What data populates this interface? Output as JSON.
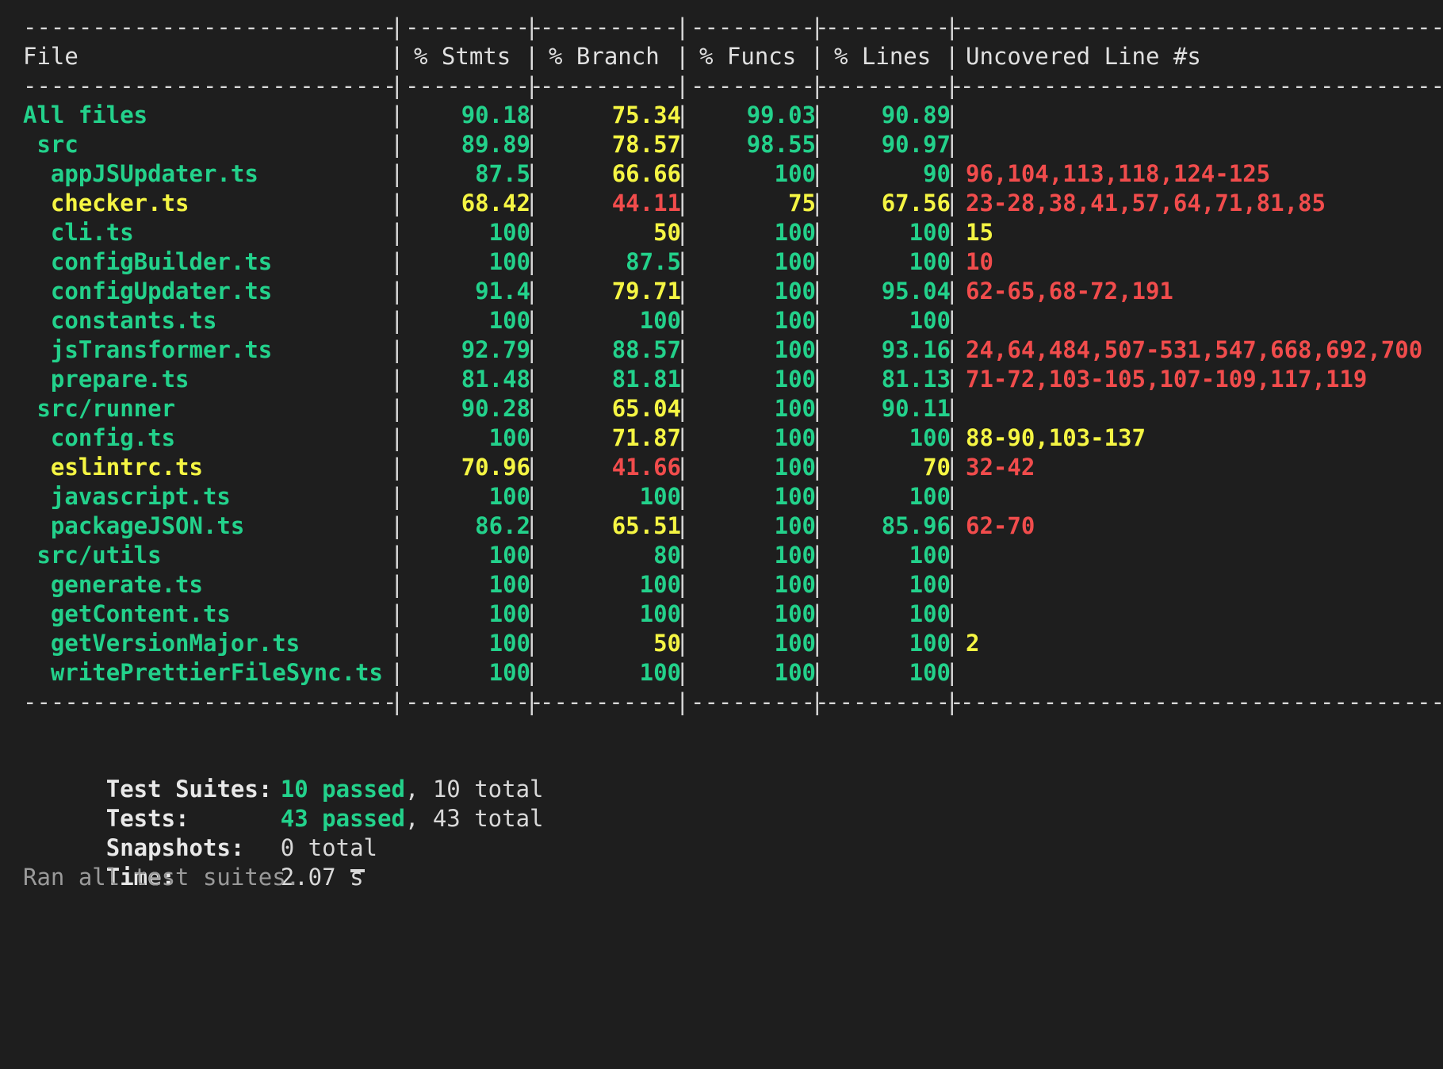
{
  "colors": {
    "background": "#1e1e1e",
    "green": "#23d18b",
    "yellow": "#f5f543",
    "red": "#f14c4c",
    "text": "#d8d8d8"
  },
  "table": {
    "separator": {
      "file": "---------------------------",
      "stmts": "----------",
      "branch": "----------",
      "funcs": "----------",
      "lines": "----------",
      "uncovered": "-----------------------------------"
    },
    "headers": {
      "file": "File",
      "stmts": "% Stmts",
      "branch": "% Branch",
      "funcs": "% Funcs",
      "lines": "% Lines",
      "uncovered": "Uncovered Line #s"
    },
    "rows": [
      {
        "file": "All files",
        "indent": "",
        "stmts": "90.18",
        "branch": "75.34",
        "funcs": "99.03",
        "lines": "90.89",
        "uncovered": ""
      },
      {
        "file": "src",
        "indent": " ",
        "stmts": "89.89",
        "branch": "78.57",
        "funcs": "98.55",
        "lines": "90.97",
        "uncovered": ""
      },
      {
        "file": "appJSUpdater.ts",
        "indent": "  ",
        "stmts": "87.5",
        "branch": "66.66",
        "funcs": "100",
        "lines": "90",
        "uncovered": "96,104,113,118,124-125"
      },
      {
        "file": "checker.ts",
        "indent": "  ",
        "stmts": "68.42",
        "branch": "44.11",
        "funcs": "75",
        "lines": "67.56",
        "uncovered": "23-28,38,41,57,64,71,81,85"
      },
      {
        "file": "cli.ts",
        "indent": "  ",
        "stmts": "100",
        "branch": "50",
        "funcs": "100",
        "lines": "100",
        "uncovered": "15"
      },
      {
        "file": "configBuilder.ts",
        "indent": "  ",
        "stmts": "100",
        "branch": "87.5",
        "funcs": "100",
        "lines": "100",
        "uncovered": "10"
      },
      {
        "file": "configUpdater.ts",
        "indent": "  ",
        "stmts": "91.4",
        "branch": "79.71",
        "funcs": "100",
        "lines": "95.04",
        "uncovered": "62-65,68-72,191"
      },
      {
        "file": "constants.ts",
        "indent": "  ",
        "stmts": "100",
        "branch": "100",
        "funcs": "100",
        "lines": "100",
        "uncovered": ""
      },
      {
        "file": "jsTransformer.ts",
        "indent": "  ",
        "stmts": "92.79",
        "branch": "88.57",
        "funcs": "100",
        "lines": "93.16",
        "uncovered": "24,64,484,507-531,547,668,692,700"
      },
      {
        "file": "prepare.ts",
        "indent": "  ",
        "stmts": "81.48",
        "branch": "81.81",
        "funcs": "100",
        "lines": "81.13",
        "uncovered": "71-72,103-105,107-109,117,119"
      },
      {
        "file": "src/runner",
        "indent": " ",
        "stmts": "90.28",
        "branch": "65.04",
        "funcs": "100",
        "lines": "90.11",
        "uncovered": ""
      },
      {
        "file": "config.ts",
        "indent": "  ",
        "stmts": "100",
        "branch": "71.87",
        "funcs": "100",
        "lines": "100",
        "uncovered": "88-90,103-137"
      },
      {
        "file": "eslintrc.ts",
        "indent": "  ",
        "stmts": "70.96",
        "branch": "41.66",
        "funcs": "100",
        "lines": "70",
        "uncovered": "32-42"
      },
      {
        "file": "javascript.ts",
        "indent": "  ",
        "stmts": "100",
        "branch": "100",
        "funcs": "100",
        "lines": "100",
        "uncovered": ""
      },
      {
        "file": "packageJSON.ts",
        "indent": "  ",
        "stmts": "86.2",
        "branch": "65.51",
        "funcs": "100",
        "lines": "85.96",
        "uncovered": "62-70"
      },
      {
        "file": "src/utils",
        "indent": " ",
        "stmts": "100",
        "branch": "80",
        "funcs": "100",
        "lines": "100",
        "uncovered": ""
      },
      {
        "file": "generate.ts",
        "indent": "  ",
        "stmts": "100",
        "branch": "100",
        "funcs": "100",
        "lines": "100",
        "uncovered": ""
      },
      {
        "file": "getContent.ts",
        "indent": "  ",
        "stmts": "100",
        "branch": "100",
        "funcs": "100",
        "lines": "100",
        "uncovered": ""
      },
      {
        "file": "getVersionMajor.ts",
        "indent": "  ",
        "stmts": "100",
        "branch": "50",
        "funcs": "100",
        "lines": "100",
        "uncovered": "2"
      },
      {
        "file": "writePrettierFileSync.ts",
        "indent": "  ",
        "stmts": "100",
        "branch": "100",
        "funcs": "100",
        "lines": "100",
        "uncovered": ""
      }
    ]
  },
  "summary": {
    "suites_label": "Test Suites:",
    "suites_passed": "10 passed",
    "suites_total": ", 10 total",
    "tests_label": "Tests:",
    "tests_passed": "43 passed",
    "tests_total": ", 43 total",
    "snapshots_label": "Snapshots:",
    "snapshots_value": "0 total",
    "time_label": "Time:",
    "time_value": "2.07 s",
    "ran_message": "Ran all test suites."
  }
}
